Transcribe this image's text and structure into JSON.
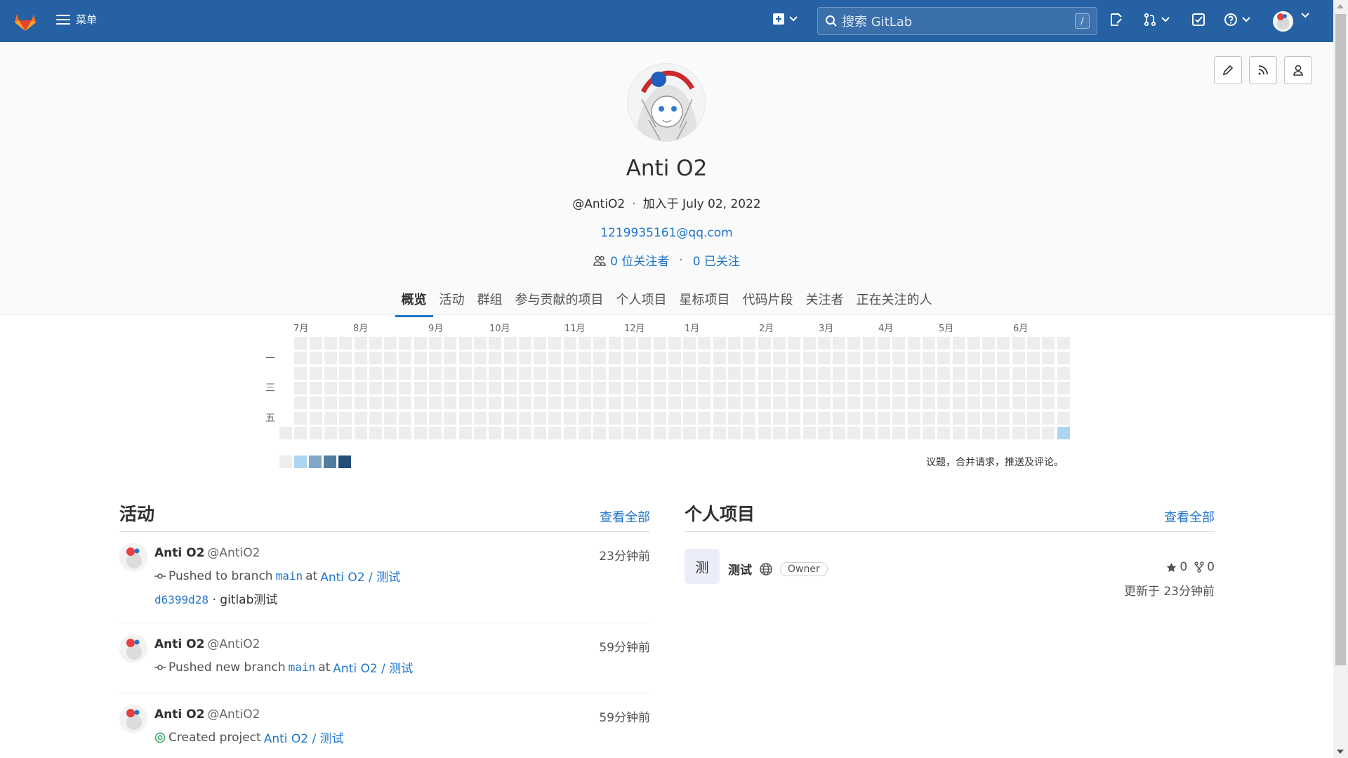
{
  "topbar": {
    "menu_label": "菜单",
    "search_placeholder": "搜索 GitLab",
    "search_shortcut": "/",
    "bg_color": "#2561a3"
  },
  "profile": {
    "name": "Anti O2",
    "handle": "@AntiO2",
    "joined": "加入于 July 02, 2022",
    "email": "1219935161@qq.com",
    "followers": "0 位关注者",
    "following": "0 已关注"
  },
  "tabs": [
    "概览",
    "活动",
    "群组",
    "参与贡献的项目",
    "个人项目",
    "星标项目",
    "代码片段",
    "关注者",
    "正在关注的人"
  ],
  "calendar": {
    "months": [
      "7月",
      "8月",
      "9月",
      "10月",
      "11月",
      "12月",
      "1月",
      "2月",
      "3月",
      "4月",
      "5月",
      "6月"
    ],
    "days": [
      "一",
      "三",
      "五"
    ],
    "note": "议题，合并请求，推送及评论。",
    "legend_colors": [
      "#ededed",
      "#acd5f2",
      "#7fa8c9",
      "#527ba0",
      "#254e77"
    ]
  },
  "activity": {
    "title": "活动",
    "view_all": "查看全部",
    "events": [
      {
        "name": "Anti O2",
        "handle": "@AntiO2",
        "time": "23分钟前",
        "action": "Pushed to branch",
        "branch": "main",
        "at": "at",
        "project": "Anti O2 / 测试",
        "commit": "d6399d28",
        "commit_msg": " · gitlab测试"
      },
      {
        "name": "Anti O2",
        "handle": "@AntiO2",
        "time": "59分钟前",
        "action": "Pushed new branch",
        "branch": "main",
        "at": "at",
        "project": "Anti O2 / 测试"
      },
      {
        "name": "Anti O2",
        "handle": "@AntiO2",
        "time": "59分钟前",
        "action": "Created project",
        "project": "Anti O2 / 测试"
      }
    ]
  },
  "projects": {
    "title": "个人项目",
    "view_all": "查看全部",
    "items": [
      {
        "avatar_letter": "测",
        "name": "测试",
        "role": "Owner",
        "stars": "0",
        "forks": "0",
        "updated": "更新于 23分钟前"
      }
    ]
  }
}
